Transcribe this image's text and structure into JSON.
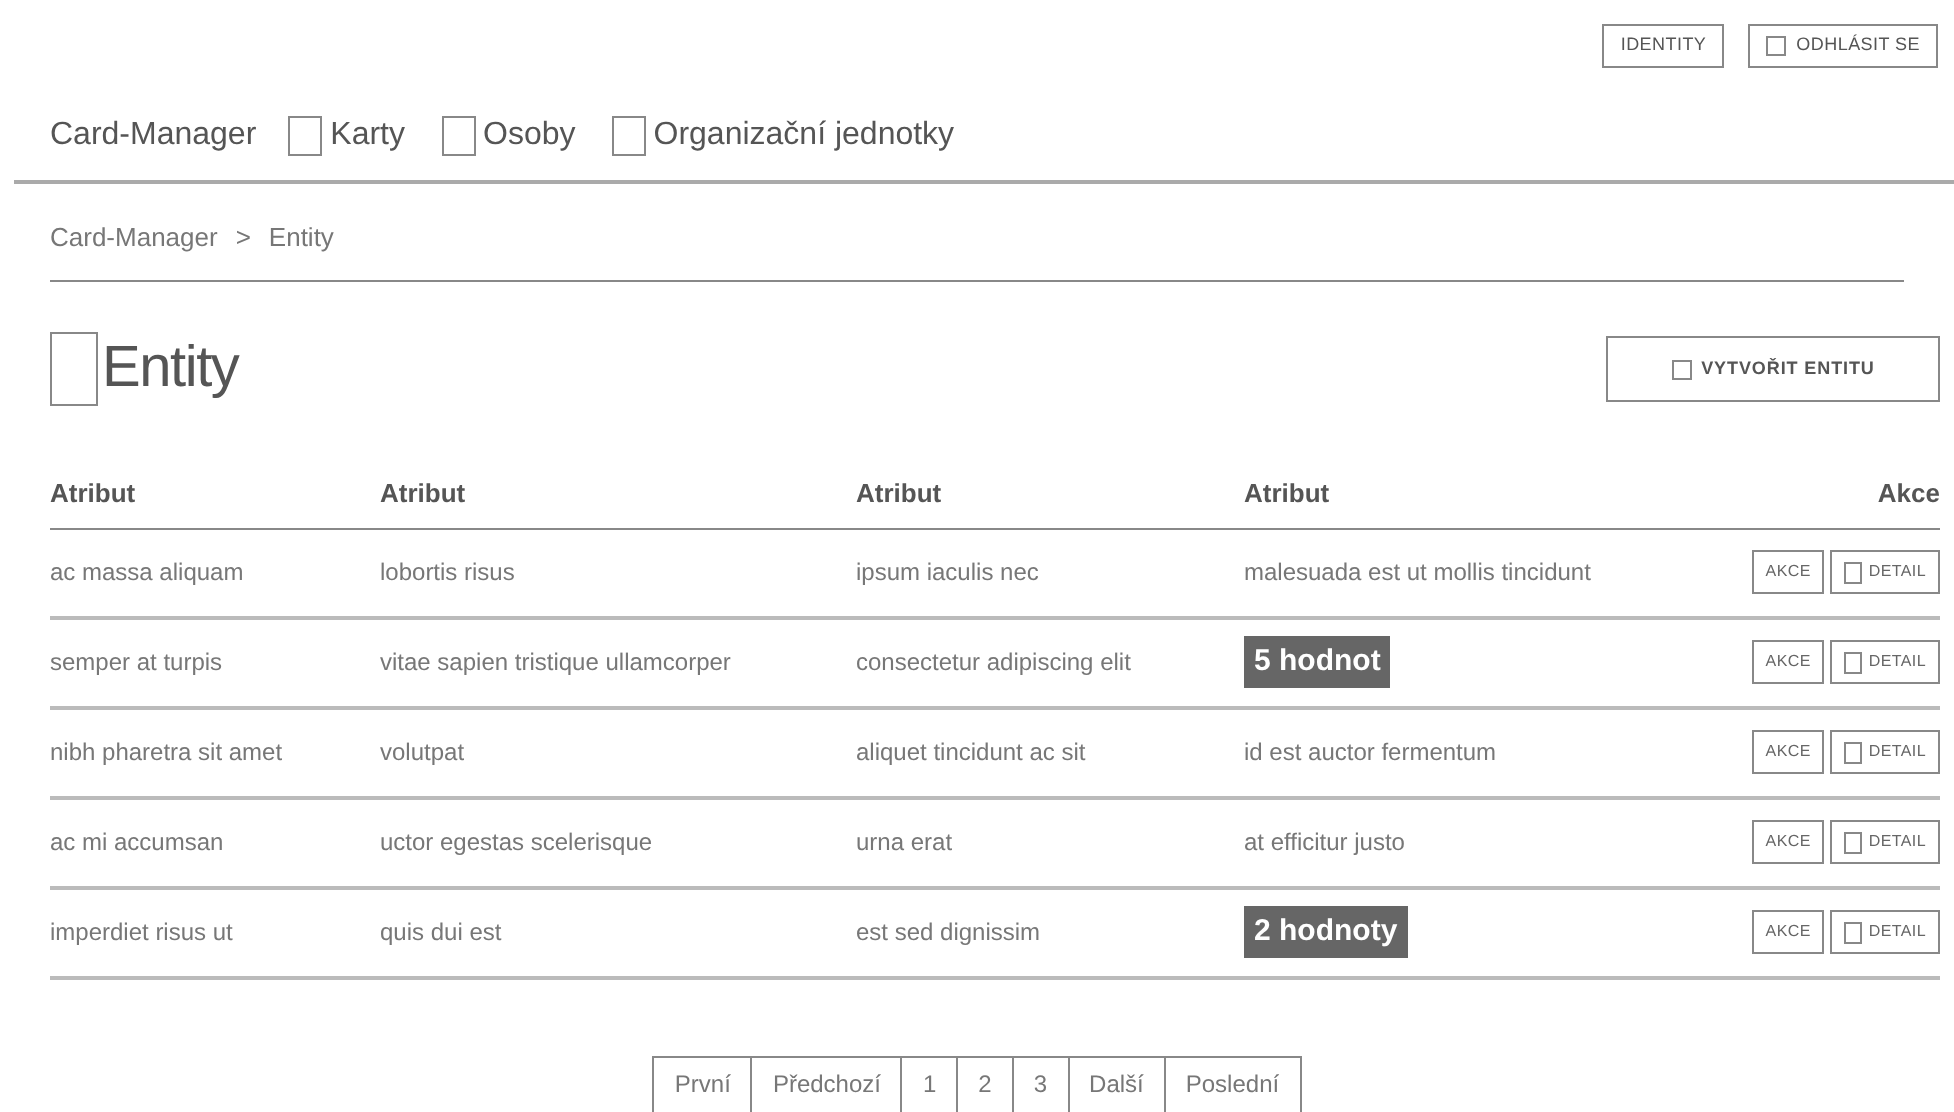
{
  "header_buttons": [
    {
      "label": "IDENTITY",
      "icon": false
    },
    {
      "label": "ODHLÁSIT SE",
      "icon": true
    }
  ],
  "brand": "Card-Manager",
  "nav": [
    {
      "label": "Karty"
    },
    {
      "label": "Osoby"
    },
    {
      "label": "Organizační jednotky"
    }
  ],
  "breadcrumb": [
    "Card-Manager",
    ">",
    "Entity"
  ],
  "page_title": "Entity",
  "create_button": "VYTVOŘIT ENTITU",
  "table": {
    "columns": [
      "Atribut",
      "Atribut",
      "Atribut",
      "Atribut",
      "Akce"
    ],
    "rows": [
      {
        "cells": [
          {
            "kind": "text",
            "text": "ac massa aliquam"
          },
          {
            "kind": "text",
            "text": "lobortis risus"
          },
          {
            "kind": "text",
            "text": "ipsum iaculis nec"
          },
          {
            "kind": "text",
            "text": "malesuada est ut mollis tincidunt"
          }
        ],
        "actions": [
          "AKCE",
          "DETAIL"
        ]
      },
      {
        "cells": [
          {
            "kind": "text",
            "text": "semper at turpis"
          },
          {
            "kind": "text",
            "text": "vitae sapien tristique ullamcorper"
          },
          {
            "kind": "text",
            "text": "consectetur adipiscing elit"
          },
          {
            "kind": "badge",
            "text": "5 hodnot"
          }
        ],
        "actions": [
          "AKCE",
          "DETAIL"
        ]
      },
      {
        "cells": [
          {
            "kind": "text",
            "text": "nibh pharetra sit amet"
          },
          {
            "kind": "text",
            "text": "volutpat"
          },
          {
            "kind": "text",
            "text": "aliquet tincidunt ac sit"
          },
          {
            "kind": "text",
            "text": "id est auctor fermentum"
          }
        ],
        "actions": [
          "AKCE",
          "DETAIL"
        ]
      },
      {
        "cells": [
          {
            "kind": "text",
            "text": "ac mi accumsan"
          },
          {
            "kind": "text",
            "text": "uctor egestas scelerisque"
          },
          {
            "kind": "text",
            "text": "urna erat"
          },
          {
            "kind": "text",
            "text": "at efficitur justo"
          }
        ],
        "actions": [
          "AKCE",
          "DETAIL"
        ]
      },
      {
        "cells": [
          {
            "kind": "text",
            "text": "imperdiet risus ut"
          },
          {
            "kind": "text",
            "text": "quis dui est"
          },
          {
            "kind": "text",
            "text": "est sed dignissim"
          },
          {
            "kind": "badge",
            "text": "2 hodnoty"
          }
        ],
        "actions": [
          "AKCE",
          "DETAIL"
        ]
      }
    ]
  },
  "pagination": [
    "První",
    "Předchozí",
    "1",
    "2",
    "3",
    "Další",
    "Poslední"
  ]
}
